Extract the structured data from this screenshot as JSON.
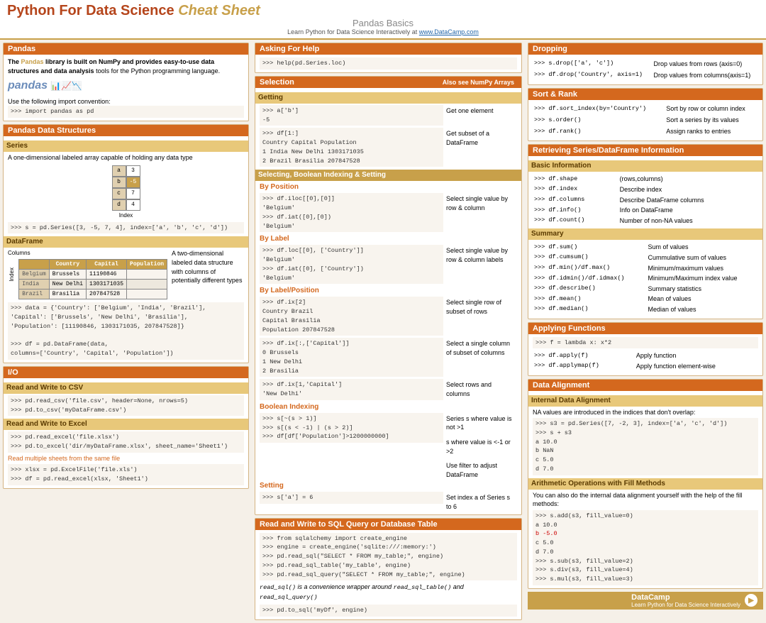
{
  "header": {
    "title_part1": "Python For Data Science",
    "title_part2": "Cheat Sheet",
    "subtitle": "Pandas Basics",
    "learn_text": "Learn Python for Data Science Interactively at",
    "learn_link": "www.DataCamp.com"
  },
  "pandas_section": {
    "title": "Pandas",
    "description_bold": "The Pandas library is built on NumPy and provides easy-to-use data structures and data analysis",
    "description_normal": " tools for the Python programming language.",
    "import_label": "Use the following import convention:",
    "import_code": ">>> import pandas as pd"
  },
  "data_structures": {
    "title": "Pandas Data Structures",
    "series_title": "Series",
    "series_desc": "A one-dimensional labeled array capable of holding any data type",
    "series_code": ">>> s = pd.Series([3, -5, 7, 4], index=['a', 'b', 'c', 'd'])",
    "dataframe_title": "DataFrame",
    "dataframe_desc": "A two-dimensional labeled data structure with columns of potentially different types",
    "df_columns_label": "Columns",
    "df_index_label": "Index",
    "df_code1": ">>> data = {'Country': ['Belgium', 'India', 'Brazil'],",
    "df_code2": "            'Capital': ['Brussels', 'New Delhi', 'Brasilia'],",
    "df_code3": "            'Population': [11190846, 1303171035, 207847528]}",
    "df_code4": "",
    "df_code5": ">>> df = pd.DataFrame(data,",
    "df_code6": "            columns=['Country', 'Capital', 'Population'])"
  },
  "io_section": {
    "title": "I/O",
    "csv_title": "Read and Write to CSV",
    "csv_code1": ">>> pd.read_csv('file.csv', header=None, nrows=5)",
    "csv_code2": ">>> pd.to_csv('myDataFrame.csv')",
    "excel_title": "Read and Write to Excel",
    "excel_code1": ">>> pd.read_excel('file.xlsx')",
    "excel_code2": ">>> pd.to_excel('dir/myDataFrame.xlsx', sheet_name='Sheet1')",
    "excel_note": "Read multiple sheets from the same file",
    "excel_code3": ">>> xlsx = pd.ExcelFile('file.xls')",
    "excel_code4": ">>> df = pd.read_excel(xlsx, 'Sheet1')"
  },
  "sql_section": {
    "title": "Read and Write to SQL Query or Database Table",
    "sql_code1": ">>> from sqlalchemy import create_engine",
    "sql_code2": ">>> engine = create_engine('sqlite:///:memory:')",
    "sql_code3": ">>> pd.read_sql(\"SELECT * FROM my_table;\", engine)",
    "sql_code4": ">>> pd.read_sql_table('my_table', engine)",
    "sql_code5": ">>> pd.read_sql_query(\"SELECT * FROM my_table;\", engine)",
    "sql_note": "read_sql() is a convenience wrapper around read_sql_table() and read_sql_query()",
    "sql_code6": ">>> pd.to_sql('myDf', engine)"
  },
  "help_section": {
    "title": "Asking For Help",
    "code": ">>> help(pd.Series.loc)"
  },
  "selection_section": {
    "title": "Selection",
    "also_see": "Also see NumPy Arrays",
    "getting_title": "Getting",
    "get_code1": ">>> a['b']",
    "get_code1_out": "-5",
    "get_desc1": "Get one element",
    "get_code2": ">>> df[1:]",
    "get_code2_out_header": "   Country  Capital   Population",
    "get_code2_out1": "1   India  New Delhi  1303171035",
    "get_code2_out2": "2  Brazil  Brasilia    207847528",
    "get_desc2": "Get subset of a DataFrame",
    "by_position_title": "Selecting, Boolean Indexing & Setting",
    "by_pos_title": "By Position",
    "by_pos_code1": ">>> df.iloc[[0],[0]]",
    "by_pos_code1_out": "'Belgium'",
    "by_pos_desc1": "Select single value by row & column",
    "by_pos_code2": ">>> df.iat([0],[0])",
    "by_pos_code2_out": "'Belgium'",
    "by_label_title": "By Label",
    "by_label_code1": ">>> df.loc[[0], ['Country']]",
    "by_label_code1_out": "'Belgium'",
    "by_label_desc1": "Select single value by row & column labels",
    "by_label_code2": ">>> df.iat([0], ['Country'])",
    "by_label_code2_out": "'Belgium'",
    "by_label_pos_title": "By Label/Position",
    "by_lp_code1": ">>> df.ix[2]",
    "by_lp_code1_out1": "Country         Brazil",
    "by_lp_code1_out2": "Capital       Brasilia",
    "by_lp_code1_out3": "Population    207847528",
    "by_lp_desc1": "Select single row of subset of rows",
    "by_lp_code2": ">>> df.ix[:,['Capital']]",
    "by_lp_code2_out1": "0    Brussels",
    "by_lp_code2_out2": "1   New Delhi",
    "by_lp_code2_out3": "2    Brasilia",
    "by_lp_desc2": "Select a single column of subset of columns",
    "by_lp_code3": ">>> df.ix[1,'Capital']",
    "by_lp_code3_out": "'New Delhi'",
    "by_lp_desc3": "Select rows and columns",
    "bool_title": "Boolean Indexing",
    "bool_code1": ">>> s[~(s > 1)]",
    "bool_desc1": "Series s where value is not >1",
    "bool_code2": ">>> s[(s < -1) | (s > 2)]",
    "bool_desc2": "s where value is <-1 or >2",
    "bool_code3": ">>> df[df['Population']>1200000000]",
    "bool_desc3": "Use filter to adjust DataFrame",
    "setting_title": "Setting",
    "set_code1": ">>> s['a'] = 6",
    "set_desc1": "Set index a of Series s to 6"
  },
  "dropping_section": {
    "title": "Dropping",
    "code1": ">>> s.drop(['a', 'c'])",
    "desc1": "Drop values from rows (axis=0)",
    "code2": ">>> df.drop('Country', axis=1)",
    "desc2": "Drop values from columns(axis=1)"
  },
  "sort_rank": {
    "title": "Sort & Rank",
    "code1": ">>> df.sort_index(by='Country')",
    "desc1": "Sort by row or column index",
    "code2": ">>> s.order()",
    "desc2": "Sort a series by its values",
    "code3": ">>> df.rank()",
    "desc3": "Assign ranks to entries"
  },
  "retrieving_section": {
    "title": "Retrieving Series/DataFrame Information",
    "basic_title": "Basic Information",
    "basic_code1": ">>> df.shape",
    "basic_desc1": "(rows,columns)",
    "basic_code2": ">>> df.index",
    "basic_desc2": "Describe index",
    "basic_code3": ">>> df.columns",
    "basic_desc3": "Describe DataFrame columns",
    "basic_code4": ">>> df.info()",
    "basic_desc4": "Info on DataFrame",
    "basic_code5": ">>> df.count()",
    "basic_desc5": "Number of non-NA values",
    "summary_title": "Summary",
    "sum_code1": ">>> df.sum()",
    "sum_desc1": "Sum of values",
    "sum_code2": ">>> df.cumsum()",
    "sum_desc2": "Cummulative sum of values",
    "sum_code3": ">>> df.min()/df.max()",
    "sum_desc3": "Minimum/maximum values",
    "sum_code4": ">>> df.idmin()/df.idmax()",
    "sum_desc4": "Minimum/Maximum index value",
    "sum_code5": ">>> df.describe()",
    "sum_desc5": "Summary statistics",
    "sum_code6": ">>> df.mean()",
    "sum_desc6": "Mean of values",
    "sum_code7": ">>> df.median()",
    "sum_desc7": "Median of values"
  },
  "applying_section": {
    "title": "Applying Functions",
    "code1": ">>> f = lambda x: x*2",
    "code2": ">>> df.apply(f)",
    "desc2": "Apply function",
    "code3": ">>> df.applymap(f)",
    "desc3": "Apply function element-wise"
  },
  "alignment_section": {
    "title": "Data Alignment",
    "internal_title": "Internal Data Alignment",
    "internal_desc": "NA values are introduced in the indices that don't overlap:",
    "internal_code1": ">>> s3 = pd.Series([7, -2, 3], index=['a', 'c', 'd'])",
    "internal_code2": ">>> s + s3",
    "internal_out1": "a    10.0",
    "internal_out2": "b     NaN",
    "internal_out3": "c     5.0",
    "internal_out4": "d     7.0",
    "fill_title": "Arithmetic Operations with Fill Methods",
    "fill_desc": "You can also do the internal data alignment yourself with the help of the fill methods:",
    "fill_code1": ">>> s.add(s3, fill_value=0)",
    "fill_out1_a": "a    10.0",
    "fill_out1_b": "b    -5.0",
    "fill_out1_c": "c     5.0",
    "fill_out1_d": "d     7.0",
    "fill_code2": ">>> s.sub(s3, fill_value=2)",
    "fill_code3": ">>> s.div(s3, fill_value=4)",
    "fill_code4": ">>> s.mul(s3, fill_value=3)"
  },
  "datacamp": {
    "name": "DataCamp",
    "tagline": "Learn Python for Data Science Interactively"
  }
}
